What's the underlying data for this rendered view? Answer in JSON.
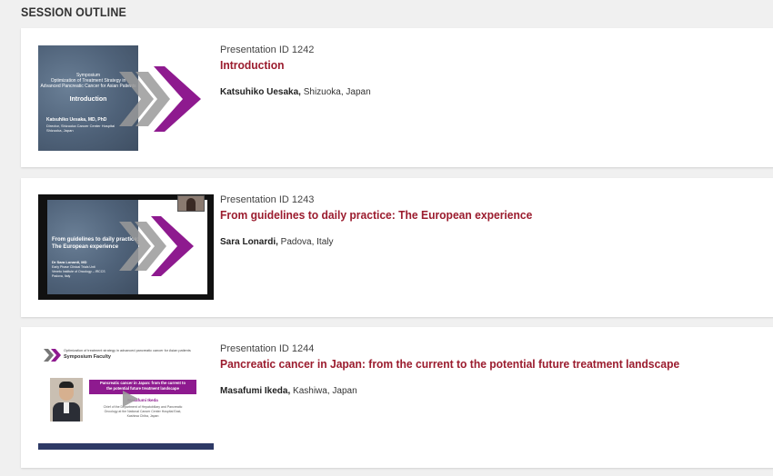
{
  "section_title": "SESSION OUTLINE",
  "colors": {
    "title_red": "#9b1c2e",
    "chevron_purple": "#8e1a8f",
    "chevron_gray": "#9a9a9a"
  },
  "presentations": [
    {
      "id_label": "Presentation ID 1242",
      "title": "Introduction",
      "speaker_name": "Katsuhiko Uesaka,",
      "speaker_location": " Shizuoka, Japan",
      "thumb": {
        "line1": "Symposium",
        "line2": "Optimization of Treatment Strategy in",
        "line3": "Advanced Pancreatic Cancer for Asian Patients",
        "heading": "Introduction",
        "presenter": "Katsuhiko Uesaka, MD, PhD",
        "role1": "Director, Shizuoka Cancer Center Hospital",
        "role2": "Shizuoka, Japan"
      },
      "play_icon": "play-icon"
    },
    {
      "id_label": "Presentation ID 1243",
      "title": "From guidelines to daily practice: The European experience",
      "speaker_name": "Sara Lonardi,",
      "speaker_location": " Padova, Italy",
      "thumb": {
        "heading1": "From guidelines to daily practice:",
        "heading2": "The European experience",
        "presenter": "Dr Sara Lonardi, MD",
        "role1": "Early Phase Clinical Trials Unit",
        "role2": "Veneto Institute of Oncology – IRCCS",
        "role3": "Padova, Italy"
      },
      "play_icon": "play-icon"
    },
    {
      "id_label": "Presentation ID 1244",
      "title": "Pancreatic cancer in Japan: from the current to the potential future treatment landscape",
      "speaker_name": "Masafumi Ikeda,",
      "speaker_location": " Kashiwa, Japan",
      "thumb": {
        "header_small": "Optimization of treatment strategy in advanced pancreatic cancer for Asian patients",
        "header_big": "Symposium Faculty",
        "banner1": "Pancreatic cancer in Japan: from the current to",
        "banner2": "the potential future treatment landscape",
        "presenter": "Masafumi Ikeda",
        "role1": "Chief of the Department of Hepatobiliary and Pancreatic",
        "role2": "Oncology at the National Cancer Center Hospital East,",
        "role3": "Kashiwa Chiba, Japan"
      },
      "play_icon": "play-icon"
    }
  ]
}
